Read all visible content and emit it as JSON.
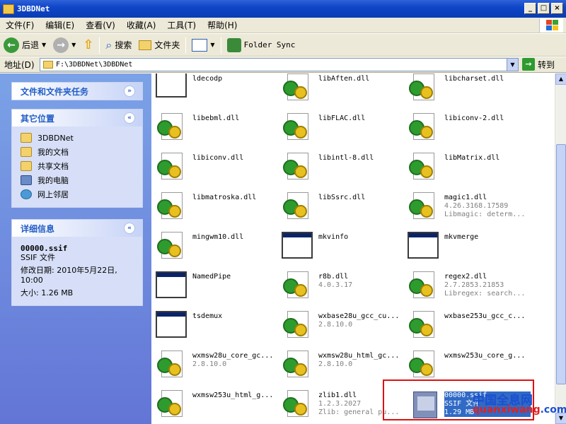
{
  "window": {
    "title": "3DBDNet"
  },
  "menu": [
    "文件(F)",
    "编辑(E)",
    "查看(V)",
    "收藏(A)",
    "工具(T)",
    "帮助(H)"
  ],
  "toolbar": {
    "back": "后退",
    "search": "搜索",
    "folders": "文件夹",
    "folder_sync": "Folder Sync"
  },
  "address": {
    "label": "地址(D)",
    "path": "F:\\3DBDNet\\3DBDNet",
    "go": "转到"
  },
  "left": {
    "tasks_title": "文件和文件夹任务",
    "other_title": "其它位置",
    "other_links": [
      "3DBDNet",
      "我的文档",
      "共享文档",
      "我的电脑",
      "网上邻居"
    ],
    "details_title": "详细信息",
    "details": {
      "name": "00000.ssif",
      "type": "SSIF 文件",
      "modified": "修改日期: 2010年5月22日, 10:00",
      "size": "大小: 1.26 MB"
    }
  },
  "files": [
    {
      "name": "ldecodp",
      "lines": [],
      "icon": "blank"
    },
    {
      "name": "libAften.dll",
      "lines": [],
      "icon": "dll"
    },
    {
      "name": "libcharset.dll",
      "lines": [],
      "icon": "dll"
    },
    {
      "name": "libebml.dll",
      "lines": [],
      "icon": "dll"
    },
    {
      "name": "libFLAC.dll",
      "lines": [],
      "icon": "dll"
    },
    {
      "name": "libiconv-2.dll",
      "lines": [],
      "icon": "dll"
    },
    {
      "name": "libiconv.dll",
      "lines": [],
      "icon": "dll"
    },
    {
      "name": "libintl-8.dll",
      "lines": [],
      "icon": "dll"
    },
    {
      "name": "libMatrix.dll",
      "lines": [],
      "icon": "dll"
    },
    {
      "name": "libmatroska.dll",
      "lines": [],
      "icon": "dll"
    },
    {
      "name": "libSsrc.dll",
      "lines": [],
      "icon": "dll"
    },
    {
      "name": "magic1.dll",
      "lines": [
        "4.26.3168.17589",
        "Libmagic: determ..."
      ],
      "icon": "dll"
    },
    {
      "name": "mingwm10.dll",
      "lines": [],
      "icon": "dll"
    },
    {
      "name": "mkvinfo",
      "lines": [],
      "icon": "window"
    },
    {
      "name": "mkvmerge",
      "lines": [],
      "icon": "window"
    },
    {
      "name": "NamedPipe",
      "lines": [],
      "icon": "window"
    },
    {
      "name": "r8b.dll",
      "lines": [
        "4.0.3.17"
      ],
      "icon": "dll"
    },
    {
      "name": "regex2.dll",
      "lines": [
        "2.7.2853.21853",
        "Libregex: search..."
      ],
      "icon": "dll"
    },
    {
      "name": "tsdemux",
      "lines": [],
      "icon": "window"
    },
    {
      "name": "wxbase28u_gcc_cu...",
      "lines": [
        "2.8.10.0"
      ],
      "icon": "dll"
    },
    {
      "name": "wxbase253u_gcc_c...",
      "lines": [],
      "icon": "dll"
    },
    {
      "name": "wxmsw28u_core_gc...",
      "lines": [
        "2.8.10.0"
      ],
      "icon": "dll"
    },
    {
      "name": "wxmsw28u_html_gc...",
      "lines": [
        "2.8.10.0"
      ],
      "icon": "dll"
    },
    {
      "name": "wxmsw253u_core_g...",
      "lines": [],
      "icon": "dll"
    },
    {
      "name": "wxmsw253u_html_g...",
      "lines": [],
      "icon": "dll"
    },
    {
      "name": "zlib1.dll",
      "lines": [
        "1.2.3.2027",
        "Zlib: general pu..."
      ],
      "icon": "dll"
    },
    {
      "name": "00000.ssif",
      "lines": [
        "SSIF 文件",
        "1.29 MB"
      ],
      "icon": "ssif",
      "selected": true
    }
  ],
  "watermark": {
    "cn": "中国全息网",
    "url_a": "quanxiwang",
    "url_b": ".com"
  },
  "colors": {
    "title": "#0a3cb4",
    "panel": "#6375d6",
    "select": "#316ac5",
    "highlight": "#e01010"
  }
}
